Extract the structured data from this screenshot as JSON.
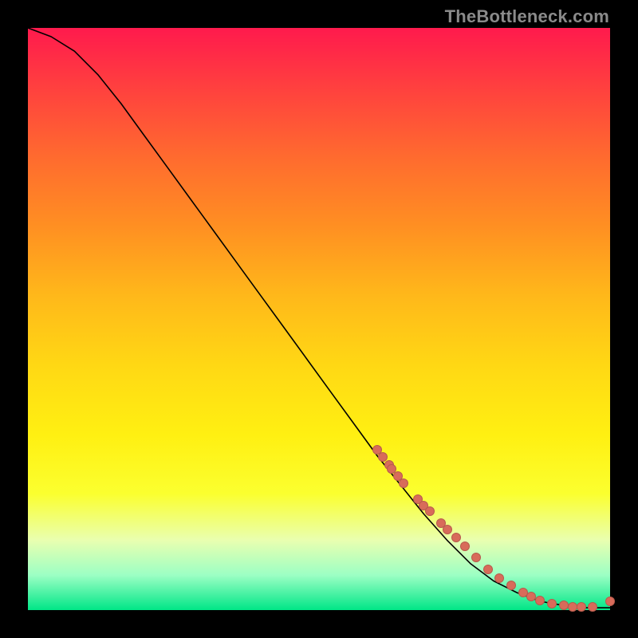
{
  "watermark": "TheBottleneck.com",
  "colors": {
    "marker": "#d86b5a",
    "curve": "#000000"
  },
  "chart_data": {
    "type": "line",
    "title": "",
    "xlabel": "",
    "ylabel": "",
    "xlim": [
      0,
      100
    ],
    "ylim": [
      0,
      100
    ],
    "grid": false,
    "legend": null,
    "series": [
      {
        "name": "curve",
        "x": [
          0,
          4,
          8,
          12,
          16,
          20,
          24,
          28,
          32,
          36,
          40,
          44,
          48,
          52,
          56,
          60,
          64,
          68,
          72,
          76,
          80,
          84,
          88,
          92,
          96,
          100
        ],
        "y": [
          100,
          98.5,
          96,
          92,
          87,
          81.5,
          76,
          70.5,
          65,
          59.5,
          54,
          48.5,
          43,
          37.5,
          32,
          26.5,
          21.5,
          16.5,
          12,
          8,
          5,
          3,
          1.5,
          0.8,
          0.4,
          0.4
        ]
      },
      {
        "name": "markers",
        "x": [
          60,
          61,
          62,
          62.5,
          63.5,
          64.5,
          67,
          68,
          69,
          71,
          72,
          73.5,
          75,
          77,
          79,
          81,
          83,
          85,
          86.5,
          88,
          90,
          92,
          93.5,
          95,
          97,
          100
        ],
        "y": [
          27.5,
          26.3,
          25,
          24.2,
          23,
          21.8,
          19,
          18,
          17,
          15,
          13.8,
          12.5,
          11,
          9,
          7,
          5.5,
          4.2,
          3,
          2.3,
          1.6,
          1.1,
          0.8,
          0.6,
          0.5,
          0.5,
          1.5
        ]
      }
    ]
  }
}
